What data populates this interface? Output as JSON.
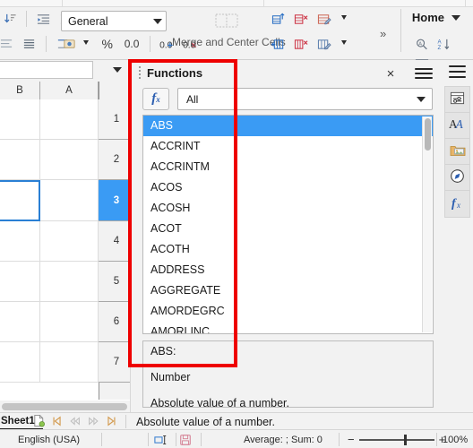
{
  "toolbar": {
    "number_format": {
      "value": "General",
      "icon": "chevron-down-icon"
    },
    "percent_label": "%",
    "decimal_label": "0.0",
    "merge_label": "Merge and Center Cells",
    "home_label": "Home",
    "overflow_label": "»",
    "icons": [
      "sort-descending-icon",
      "increase-indent-icon",
      "decrease-indent-icon",
      "wrap-text-icon",
      "align-justify-icon",
      "text-direction-icon",
      "currency-icon",
      "percent-icon",
      "add-decimal-icon",
      "delete-decimal-icon",
      "merge-cells-icon",
      "insert-rows-icon",
      "delete-rows-icon",
      "row-format-icon",
      "insert-columns-icon",
      "delete-columns-icon",
      "column-format-icon",
      "find-replace-icon",
      "sort-icon",
      "autofilter-icon"
    ]
  },
  "sheet": {
    "columns": [
      "B",
      "A"
    ],
    "rows": [
      "1",
      "2",
      "3",
      "4",
      "5",
      "6",
      "7"
    ],
    "selected_row": "3"
  },
  "functions_panel": {
    "title": "Functions",
    "close_label": "×",
    "menu_icon": "hamburger-menu-icon",
    "fx_button": {
      "label": "f",
      "sub": "x",
      "name": "function-wizard-icon"
    },
    "category": {
      "value": "All",
      "icon": "chevron-down-icon"
    },
    "list": [
      "ABS",
      "ACCRINT",
      "ACCRINTM",
      "ACOS",
      "ACOSH",
      "ACOT",
      "ACOTH",
      "ADDRESS",
      "AGGREGATE",
      "AMORDEGRC",
      "AMORLINC"
    ],
    "selected": "ABS",
    "description": {
      "name": "ABS:",
      "argument": "Number",
      "text": "Absolute value of a number."
    }
  },
  "sidebar": {
    "menu_icon": "sidebar-hamburger-icon",
    "items": [
      {
        "name": "properties-icon",
        "label": "Properties"
      },
      {
        "name": "styles-icon",
        "label": "Styles"
      },
      {
        "name": "gallery-icon",
        "label": "Gallery"
      },
      {
        "name": "navigator-icon",
        "label": "Navigator"
      },
      {
        "name": "functions-icon",
        "label": "Functions"
      }
    ]
  },
  "tabbar": {
    "sheet_name": "Sheet1",
    "add_sheet_icon": "add-sheet-icon",
    "nav_icons": [
      "first-sheet-icon",
      "previous-sheet-icon",
      "next-sheet-icon",
      "last-sheet-icon"
    ],
    "description_echo": "Absolute value of a number."
  },
  "statusbar": {
    "language": "English (USA)",
    "selection_mode_icon": "selection-mode-icon",
    "save_icon": "document-modified-icon",
    "summary": "Average: ; Sum: 0",
    "zoom_out": "−",
    "zoom_in": "+",
    "zoom_level": "100%"
  },
  "annotation": {
    "color": "#ee0000",
    "shape": "rectangle"
  }
}
